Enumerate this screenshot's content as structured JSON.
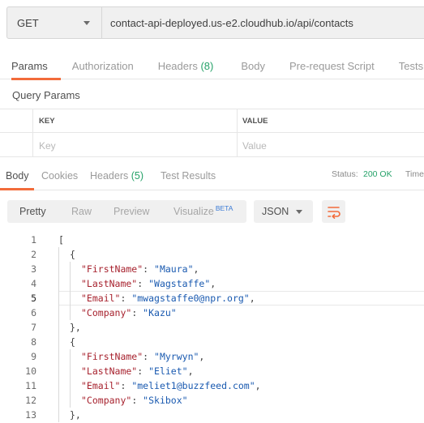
{
  "request": {
    "method": "GET",
    "url": "contact-api-deployed.us-e2.cloudhub.io/api/contacts"
  },
  "request_tabs": [
    {
      "label": "Params",
      "count": ""
    },
    {
      "label": "Authorization",
      "count": ""
    },
    {
      "label": "Headers",
      "count": "(8)"
    },
    {
      "label": "Body",
      "count": ""
    },
    {
      "label": "Pre-request Script",
      "count": ""
    },
    {
      "label": "Tests",
      "count": ""
    }
  ],
  "query_params": {
    "title": "Query Params",
    "key_header": "KEY",
    "value_header": "VALUE",
    "key_placeholder": "Key",
    "value_placeholder": "Value"
  },
  "response_tabs": [
    {
      "label": "Body",
      "count": ""
    },
    {
      "label": "Cookies",
      "count": ""
    },
    {
      "label": "Headers",
      "count": "(5)"
    },
    {
      "label": "Test Results",
      "count": ""
    }
  ],
  "status": {
    "label": "Status:",
    "value": "200 OK",
    "time_label": "Time"
  },
  "view_modes": [
    "Pretty",
    "Raw",
    "Preview",
    "Visualize"
  ],
  "beta_label": "BETA",
  "format": "JSON",
  "icons": {
    "method_dropdown": "chevron-down-icon",
    "format_dropdown": "chevron-down-icon",
    "wrap": "wrap-lines-icon"
  },
  "colors": {
    "accent": "#f26b3a",
    "status_ok": "#26a269",
    "json_key": "#a7222e",
    "json_string": "#1a5ab0"
  },
  "current_line": 5,
  "code_lines": [
    {
      "n": "1",
      "indent": 0,
      "text": "["
    },
    {
      "n": "2",
      "indent": 1,
      "text": "{"
    },
    {
      "n": "3",
      "indent": 2,
      "key": "\"FirstName\"",
      "val": "\"Maura\"",
      "tail": ","
    },
    {
      "n": "4",
      "indent": 2,
      "key": "\"LastName\"",
      "val": "\"Wagstaffe\"",
      "tail": ","
    },
    {
      "n": "5",
      "indent": 2,
      "key": "\"Email\"",
      "val": "\"mwagstaffe0@npr.org\"",
      "tail": ","
    },
    {
      "n": "6",
      "indent": 2,
      "key": "\"Company\"",
      "val": "\"Kazu\"",
      "tail": ""
    },
    {
      "n": "7",
      "indent": 1,
      "text": "},"
    },
    {
      "n": "8",
      "indent": 1,
      "text": "{"
    },
    {
      "n": "9",
      "indent": 2,
      "key": "\"FirstName\"",
      "val": "\"Myrwyn\"",
      "tail": ","
    },
    {
      "n": "10",
      "indent": 2,
      "key": "\"LastName\"",
      "val": "\"Eliet\"",
      "tail": ","
    },
    {
      "n": "11",
      "indent": 2,
      "key": "\"Email\"",
      "val": "\"meliet1@buzzfeed.com\"",
      "tail": ","
    },
    {
      "n": "12",
      "indent": 2,
      "key": "\"Company\"",
      "val": "\"Skibox\"",
      "tail": ""
    },
    {
      "n": "13",
      "indent": 1,
      "text": "},"
    }
  ]
}
